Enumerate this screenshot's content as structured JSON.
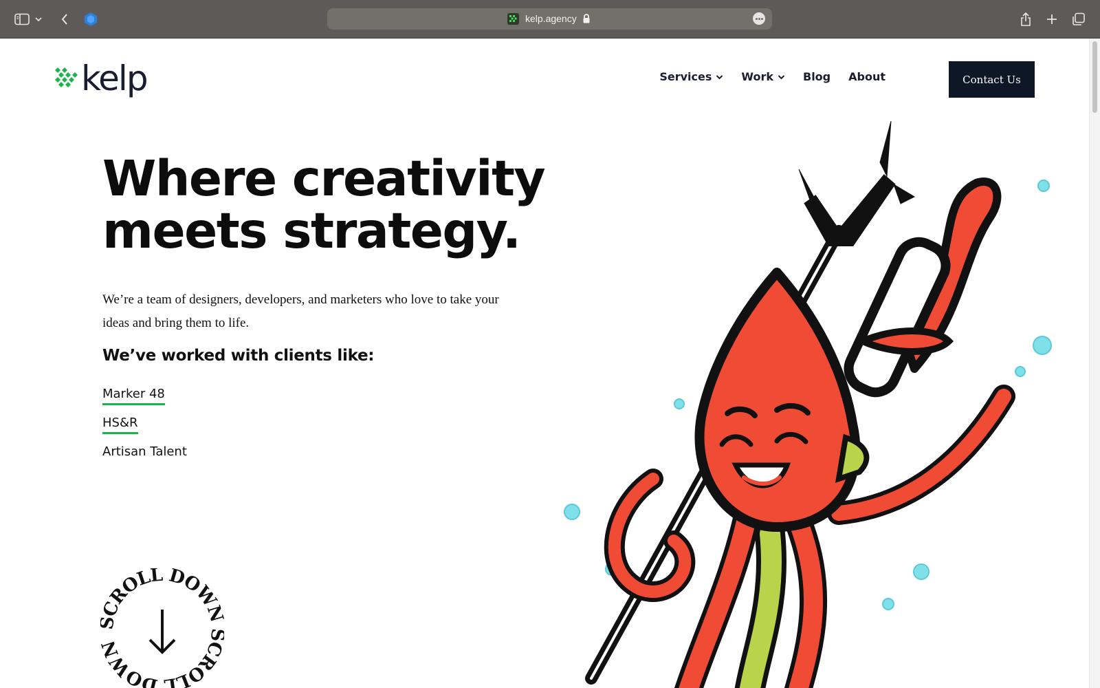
{
  "browser": {
    "url": "kelp.agency"
  },
  "site": {
    "logo_text": "kelp",
    "nav": [
      {
        "label": "Services",
        "has_dropdown": true
      },
      {
        "label": "Work",
        "has_dropdown": true
      },
      {
        "label": "Blog",
        "has_dropdown": false
      },
      {
        "label": "About",
        "has_dropdown": false
      }
    ],
    "contact_label": "Contact Us"
  },
  "hero": {
    "title_line1": "Where creativity",
    "title_line2": "meets strategy.",
    "description": "We’re a team of designers, developers, and marketers who love to take your ideas and bring them to life.",
    "clients_heading": "We’ve worked with clients like:",
    "clients": [
      {
        "name": "Marker 48",
        "underlined": true
      },
      {
        "name": "HS&R",
        "underlined": true
      },
      {
        "name": "Artisan Talent",
        "underlined": false
      }
    ],
    "scroll_badge_text": "SCROLL DOWN SCROLL DOWN "
  },
  "colors": {
    "brand_green": "#1ab54a",
    "navy": "#0e1726",
    "octopus_red": "#ef4b35",
    "bubble": "#7fe0ea"
  },
  "icons": [
    "sidebar-icon",
    "chevron-down-icon",
    "back-arrow-icon",
    "extension-icon",
    "lock-icon",
    "more-icon",
    "share-icon",
    "new-tab-icon",
    "tabs-overview-icon",
    "scroll-arrow-icon"
  ]
}
